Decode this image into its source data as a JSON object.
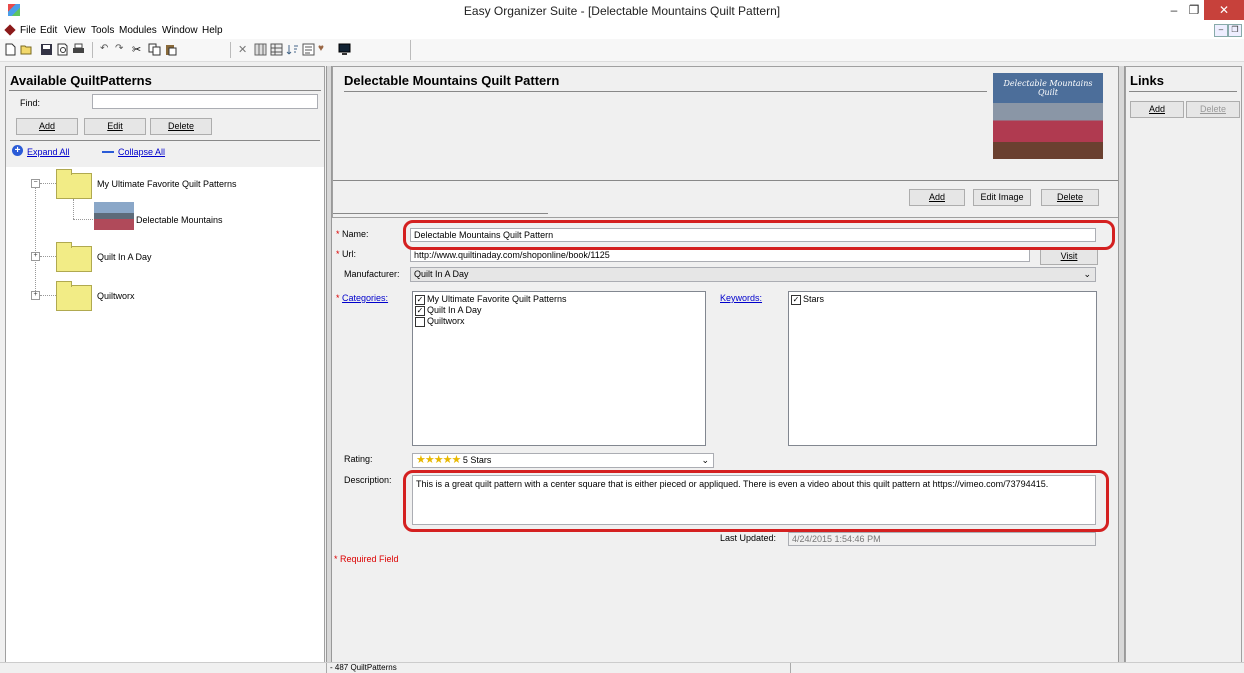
{
  "window": {
    "title": "Easy Organizer Suite - [Delectable Mountains Quilt Pattern]",
    "minimize": "–",
    "restore": "❐",
    "close": "✕"
  },
  "menu": [
    "File",
    "Edit",
    "View",
    "Tools",
    "Modules",
    "Window",
    "Help"
  ],
  "left_panel": {
    "title": "Available QuiltPatterns",
    "find_label": "Find:",
    "find_value": "",
    "add": "Add",
    "edit": "Edit",
    "delete": "Delete",
    "expand_all": "Expand All",
    "collapse_all": "Collapse All",
    "tree": [
      {
        "label": "My Ultimate Favorite Quilt Patterns",
        "expanded": true,
        "children": [
          {
            "label": "Delectable Mountains"
          }
        ]
      },
      {
        "label": "Quilt In A Day",
        "expanded": false
      },
      {
        "label": "Quiltworx",
        "expanded": false
      }
    ]
  },
  "detail": {
    "title": "Delectable Mountains Quilt Pattern",
    "image_add": "Add",
    "image_edit": "Edit Image",
    "image_delete": "Delete",
    "cover_text": "Delectable Mountains Quilt",
    "name_label": "Name:",
    "name_value": "Delectable Mountains Quilt Pattern",
    "url_label": "Url:",
    "url_value": "http://www.quiltinaday.com/shoponline/book/1125",
    "visit": "Visit",
    "manufacturer_label": "Manufacturer:",
    "manufacturer_value": "Quilt In A Day",
    "categories_label": "Categories:",
    "categories": [
      {
        "label": "My Ultimate Favorite Quilt Patterns",
        "checked": true
      },
      {
        "label": "Quilt In A Day",
        "checked": true
      },
      {
        "label": "Quiltworx",
        "checked": false
      }
    ],
    "keywords_label": "Keywords:",
    "keywords": [
      {
        "label": "Stars",
        "checked": true
      }
    ],
    "rating_label": "Rating:",
    "rating_value": "5 Stars",
    "rating_stars": 5,
    "description_label": "Description:",
    "description_value": "This is a great quilt pattern with a center square that is either pieced or appliqued.  There is even a video about this quilt pattern at https://vimeo.com/73794415.",
    "last_updated_label": "Last Updated:",
    "last_updated_value": "4/24/2015 1:54:46 PM",
    "required_note": "Required Field",
    "required_mark": "*"
  },
  "links_panel": {
    "title": "Links",
    "add": "Add",
    "delete": "Delete"
  },
  "status": {
    "count": "- 487 QuiltPatterns"
  },
  "colors": {
    "highlight": "#d42020",
    "link": "#0000cc",
    "folder": "#f2ec86"
  }
}
